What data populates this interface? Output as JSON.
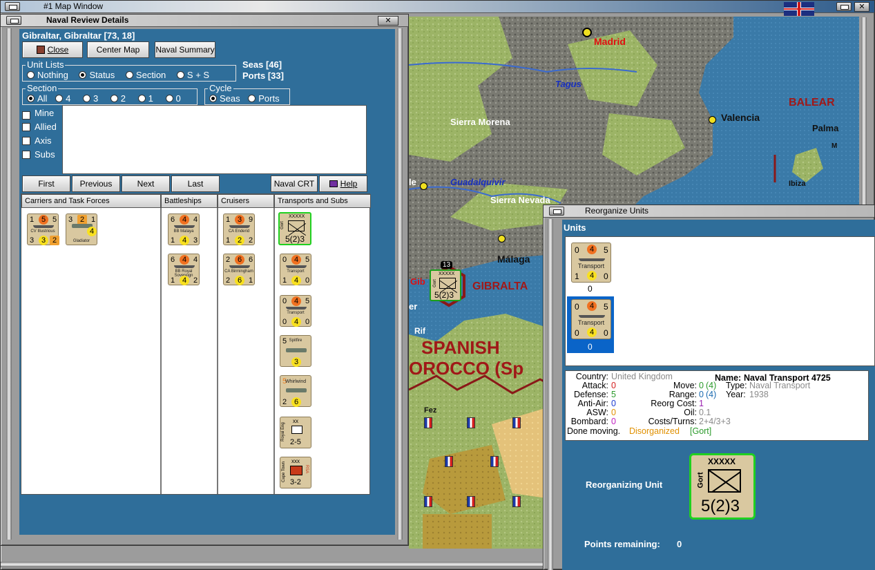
{
  "map_window": {
    "title": "#1 Map Window"
  },
  "naval_review": {
    "title": "Naval Review Details",
    "location": "Gibraltar, Gibraltar [73, 18]",
    "buttons": {
      "close": "Close",
      "center_map": "Center Map",
      "naval_summary": "Naval Summary"
    },
    "unit_lists": {
      "legend": "Unit Lists",
      "options": [
        "Nothing",
        "Status",
        "Section",
        "S + S"
      ],
      "selected": "Status"
    },
    "seas": "Seas [46]",
    "ports": "Ports [33]",
    "section": {
      "legend": "Section",
      "options": [
        "All",
        "4",
        "3",
        "2",
        "1",
        "0"
      ],
      "selected": "All"
    },
    "cycle": {
      "legend": "Cycle",
      "options": [
        "Seas",
        "Ports"
      ],
      "selected": "Seas"
    },
    "filters": [
      {
        "label": "Mine",
        "checked": true
      },
      {
        "label": "Allied",
        "checked": false
      },
      {
        "label": "Axis",
        "checked": false
      },
      {
        "label": "Subs",
        "checked": false
      }
    ],
    "nav_buttons": {
      "first": "First",
      "previous": "Previous",
      "next": "Next",
      "last": "Last",
      "naval_crt": "Naval CRT",
      "help": "Help"
    },
    "columns": [
      "Carriers and Task Forces",
      "Battleships",
      "Cruisers",
      "Transports and Subs"
    ],
    "carriers": [
      {
        "name": "CV Illustrious",
        "tl": "1",
        "tm": "5",
        "tr": "5",
        "bl": "3",
        "bm": "3",
        "br": "2"
      },
      {
        "name": "Gladiator",
        "tl": "3",
        "tm": "2",
        "tr": "1",
        "bm": "4"
      }
    ],
    "battleships": [
      {
        "name": "BB Malaya",
        "tl": "6",
        "tm": "4",
        "tr": "4",
        "bl": "1",
        "bm": "4",
        "br": "3"
      },
      {
        "name": "BB Royal Sovereign",
        "tl": "6",
        "tm": "4",
        "tr": "4",
        "bl": "1",
        "bm": "4",
        "br": "2"
      }
    ],
    "cruisers": [
      {
        "name": "CA Enderid",
        "tl": "1",
        "tm": "3",
        "tr": "9",
        "bl": "1",
        "bm": "2",
        "br": "2"
      },
      {
        "name": "CA Birmingham",
        "tl": "2",
        "tm": "6",
        "tr": "6",
        "bl": "2",
        "bm": "6",
        "br": "1"
      }
    ],
    "transports": [
      {
        "name": "Gort",
        "top": "XXXXX",
        "bottom": "5(2)3"
      },
      {
        "name": "Transport",
        "tl": "0",
        "tm": "4",
        "tr": "5",
        "bl": "1",
        "bm": "4",
        "br": "0"
      },
      {
        "name": "Transport",
        "tl": "0",
        "tm": "4",
        "tr": "5",
        "bl": "0",
        "bm": "4",
        "br": "0"
      },
      {
        "name": "Spitfire",
        "tl": "5",
        "bm": "3"
      },
      {
        "name": "Whirlwind",
        "tl": "5",
        "bl": "2",
        "bm": "6"
      },
      {
        "name": "Royal Eng",
        "top": "xx",
        "bottom": "2-5"
      },
      {
        "name": "Cape Town",
        "top": "xxx",
        "bottom": "3-2",
        "side": "RSA"
      }
    ]
  },
  "map": {
    "labels": {
      "madrid": "Madrid",
      "tagus": "Tagus",
      "sierra_morena": "Sierra Morena",
      "valencia": "Valencia",
      "balear": "BALEAR",
      "palma": "Palma",
      "ibiza": "Ibiza",
      "guadalquivir": "Guadalquivir",
      "sierra_nevada": "Sierra Nevada",
      "malaga": "Málaga",
      "gibraltar": "GIBRALTA",
      "gib": "Gib",
      "er": "er",
      "rif": "Rif",
      "spanish": "SPANISH",
      "morocco": "OROCCO (Sp",
      "fez": "Fez",
      "le": "le",
      "m": "M"
    },
    "stack_count": "13",
    "gort_counter": {
      "top": "XXXXX",
      "name": "Gort",
      "bottom": "5(2)3"
    }
  },
  "reorganize": {
    "title": "Reorganize Units",
    "units_label": "Units",
    "units": [
      {
        "tl": "0",
        "tm": "4",
        "tr": "5",
        "name": "Transport",
        "bl": "1",
        "bm": "4",
        "br": "0",
        "under": "0",
        "selected": false
      },
      {
        "tl": "0",
        "tm": "4",
        "tr": "5",
        "name": "Transport",
        "bl": "0",
        "bm": "4",
        "br": "0",
        "under": "0",
        "selected": true
      }
    ],
    "details": {
      "country_label": "Country:",
      "country": "United Kingdom",
      "name_label": "Name:",
      "name": "Naval Transport 4725",
      "attack_label": "Attack:",
      "attack": "0",
      "move_label": "Move:",
      "move": "0",
      "move_paren": "(4)",
      "type_label": "Type:",
      "type": "Naval Transport",
      "defense_label": "Defense:",
      "defense": "5",
      "range_label": "Range:",
      "range": "0",
      "range_paren": "(4)",
      "year_label": "Year:",
      "year": "1938",
      "aa_label": "Anti-Air:",
      "aa": "0",
      "reorg_label": "Reorg Cost:",
      "reorg": "1",
      "asw_label": "ASW:",
      "asw": "0",
      "oil_label": "Oil:",
      "oil": "0.1",
      "bombard_label": "Bombard:",
      "bombard": "0",
      "costs_label": "Costs/Turns:",
      "costs": "2+4/3+3",
      "done": "Done moving.",
      "disorganized": "Disorganized",
      "gort": "[Gort]"
    },
    "reorganizing_label": "Reorganizing Unit",
    "big_counter": {
      "top": "XXXXX",
      "name": "Gort",
      "bottom": "5(2)3"
    },
    "points_label": "Points remaining:",
    "points": "0"
  },
  "colors": {
    "panel_blue": "#2f6e9a",
    "selected": "#0a64c8",
    "attack_red": "#d42020",
    "defense_green": "#2a9a2a",
    "disorganized": "#e09000"
  }
}
